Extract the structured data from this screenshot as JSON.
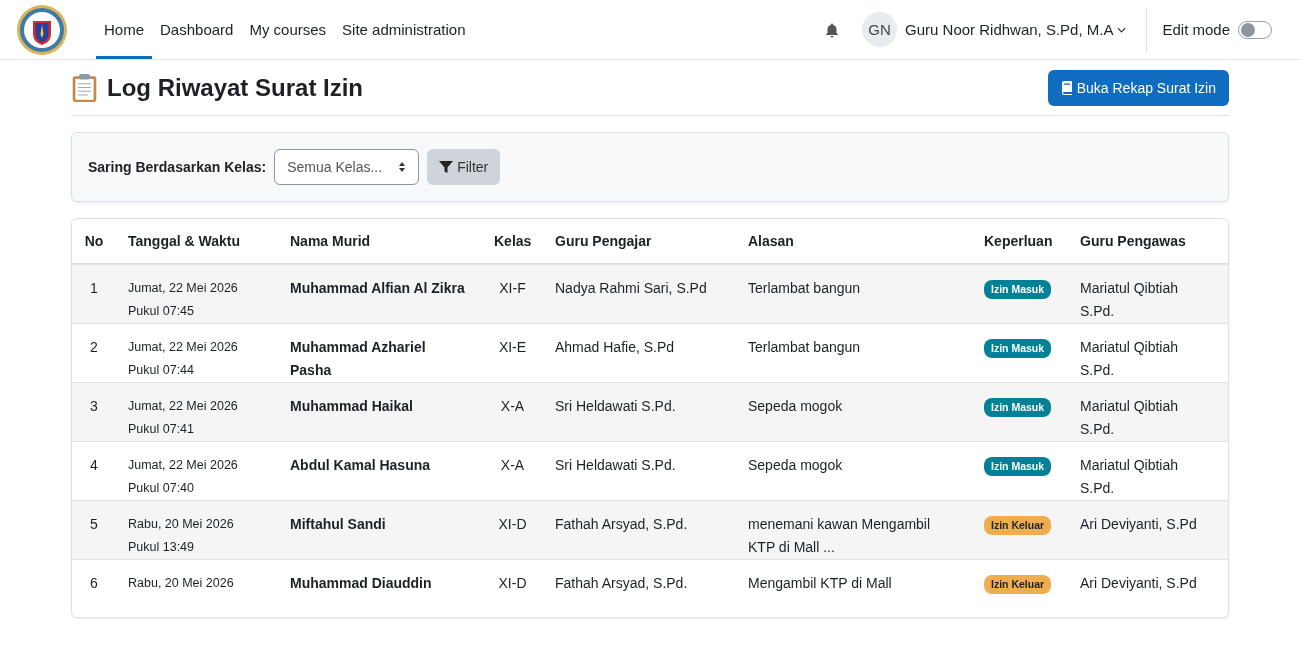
{
  "nav": {
    "items": [
      {
        "label": "Home",
        "selected": true
      },
      {
        "label": "Dashboard",
        "selected": false
      },
      {
        "label": "My courses",
        "selected": false
      },
      {
        "label": "Site administration",
        "selected": false
      }
    ],
    "user": {
      "initials": "GN",
      "name": "Guru Noor Ridhwan, S.Pd, M.A"
    },
    "edit_mode": {
      "label": "Edit mode",
      "on": false
    }
  },
  "page": {
    "title": "Log Riwayat Surat Izin",
    "button": "Buka Rekap Surat Izin"
  },
  "filter": {
    "label": "Saring Berdasarkan Kelas:",
    "select_value": "Semua Kelas...",
    "button": "Filter"
  },
  "table": {
    "columns": [
      "No",
      "Tanggal & Waktu",
      "Nama Murid",
      "Kelas",
      "Guru Pengajar",
      "Alasan",
      "Keperluan",
      "Guru Pengawas"
    ],
    "rows": [
      {
        "no": "1",
        "date": "Jumat, 22 Mei 2026",
        "time": "Pukul 07:45",
        "name": "Muhammad Alfian Al Zikra",
        "class": "XI-F",
        "teacher": "Nadya Rahmi Sari, S.Pd",
        "reason": "Terlambat bangun",
        "purpose": {
          "label": "Izin Masuk",
          "kind": "masuk"
        },
        "supervisor": "Mariatul Qibtiah S.Pd."
      },
      {
        "no": "2",
        "date": "Jumat, 22 Mei 2026",
        "time": "Pukul 07:44",
        "name": "Muhammad Azhariel Pasha",
        "class": "XI-E",
        "teacher": "Ahmad Hafie, S.Pd",
        "reason": "Terlambat bangun",
        "purpose": {
          "label": "Izin Masuk",
          "kind": "masuk"
        },
        "supervisor": "Mariatul Qibtiah S.Pd."
      },
      {
        "no": "3",
        "date": "Jumat, 22 Mei 2026",
        "time": "Pukul 07:41",
        "name": "Muhammad Haikal",
        "class": "X-A",
        "teacher": "Sri Heldawati S.Pd.",
        "reason": "Sepeda mogok",
        "purpose": {
          "label": "Izin Masuk",
          "kind": "masuk"
        },
        "supervisor": "Mariatul Qibtiah S.Pd."
      },
      {
        "no": "4",
        "date": "Jumat, 22 Mei 2026",
        "time": "Pukul 07:40",
        "name": "Abdul Kamal Hasuna",
        "class": "X-A",
        "teacher": "Sri Heldawati S.Pd.",
        "reason": "Sepeda mogok",
        "purpose": {
          "label": "Izin Masuk",
          "kind": "masuk"
        },
        "supervisor": "Mariatul Qibtiah S.Pd."
      },
      {
        "no": "5",
        "date": "Rabu, 20 Mei 2026",
        "time": "Pukul 13:49",
        "name": "Miftahul Sandi",
        "class": "XI-D",
        "teacher": "Fathah Arsyad, S.Pd.",
        "reason": "menemani kawan Mengambil KTP di Mall ...",
        "purpose": {
          "label": "Izin Keluar",
          "kind": "keluar"
        },
        "supervisor": "Ari Deviyanti, S.Pd"
      },
      {
        "no": "6",
        "date": "Rabu, 20 Mei 2026",
        "time": "",
        "name": "Muhammad Diauddin",
        "class": "XI-D",
        "teacher": "Fathah Arsyad, S.Pd.",
        "reason": "Mengambil KTP di Mall",
        "purpose": {
          "label": "Izin Keluar",
          "kind": "keluar"
        },
        "supervisor": "Ari Deviyanti, S.Pd"
      }
    ]
  }
}
